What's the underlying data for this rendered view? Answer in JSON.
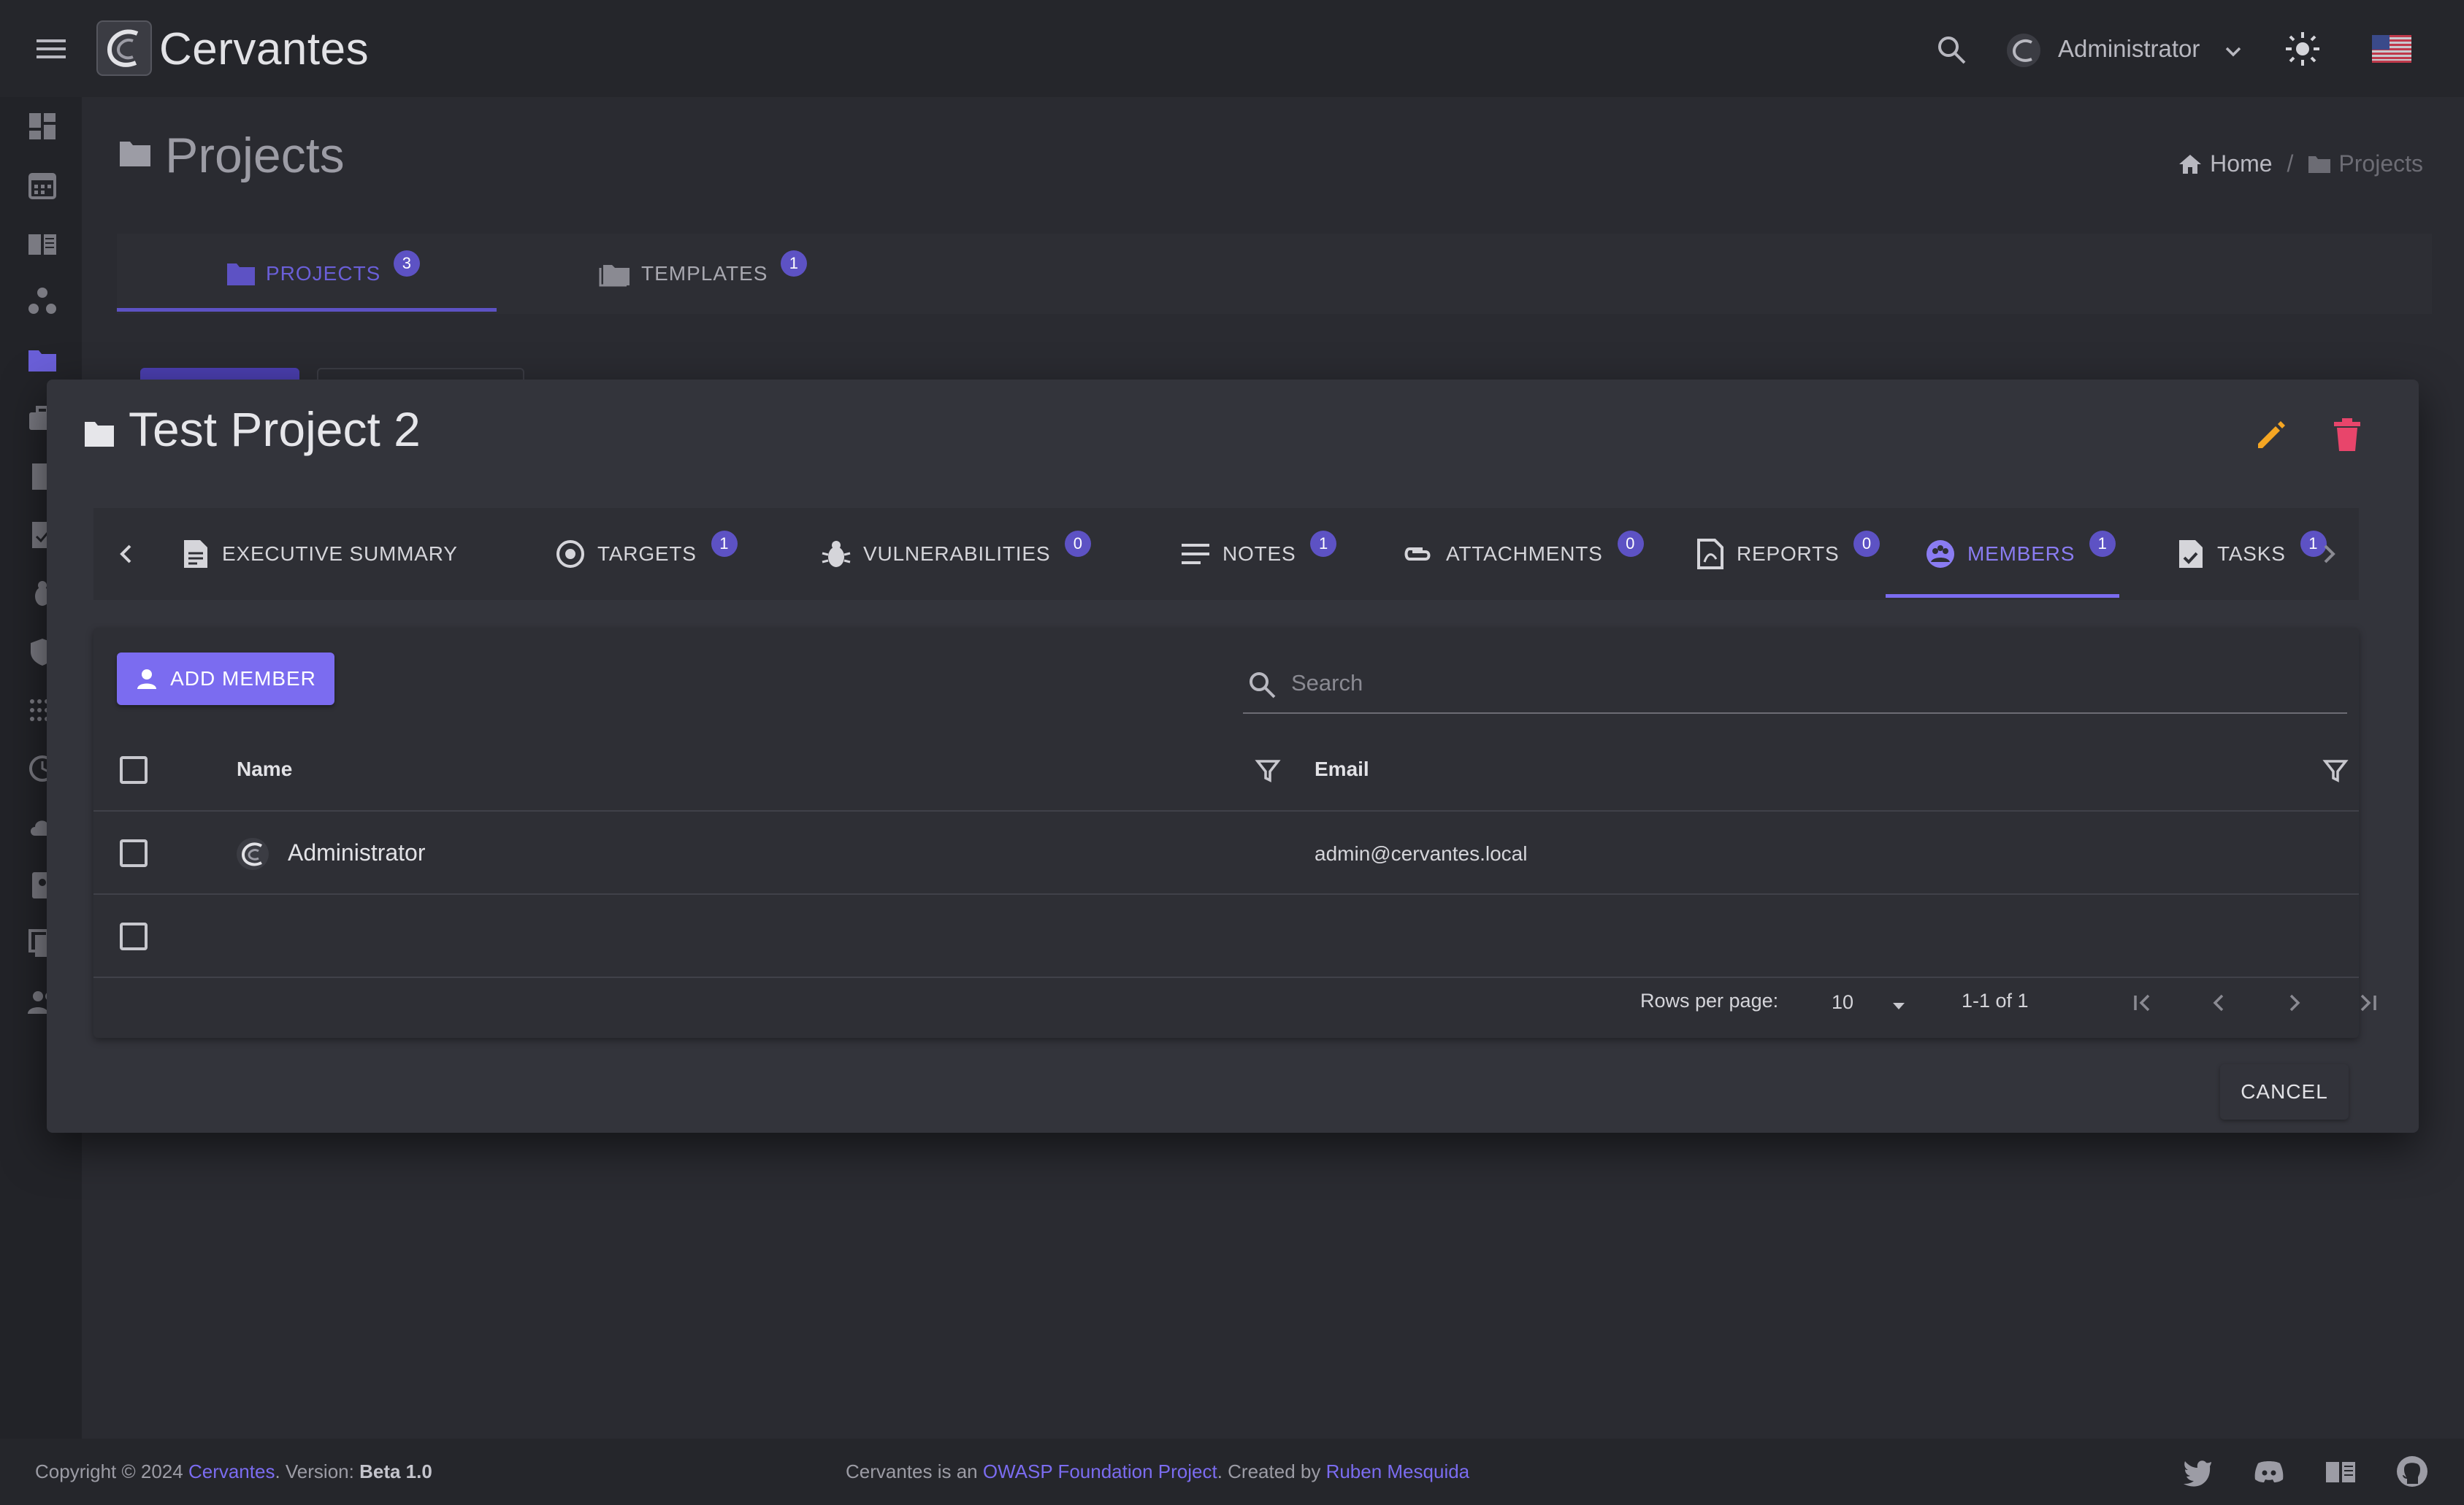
{
  "app": {
    "brand": "Cervantes"
  },
  "topbar": {
    "user": "Administrator"
  },
  "page": {
    "title": "Projects",
    "breadcrumb": {
      "home": "Home",
      "current": "Projects"
    },
    "tabs": [
      {
        "label": "PROJECTS",
        "badge": "3"
      },
      {
        "label": "TEMPLATES",
        "badge": "1"
      }
    ]
  },
  "dialog": {
    "title": "Test Project 2",
    "tabs": [
      {
        "label": "EXECUTIVE SUMMARY",
        "badge": ""
      },
      {
        "label": "TARGETS",
        "badge": "1"
      },
      {
        "label": "VULNERABILITIES",
        "badge": "0"
      },
      {
        "label": "NOTES",
        "badge": "1"
      },
      {
        "label": "ATTACHMENTS",
        "badge": "0"
      },
      {
        "label": "REPORTS",
        "badge": "0"
      },
      {
        "label": "MEMBERS",
        "badge": "1"
      },
      {
        "label": "TASKS",
        "badge": "1"
      }
    ],
    "add_member_label": "ADD MEMBER",
    "search_placeholder": "Search",
    "table": {
      "columns": [
        "Name",
        "Email"
      ],
      "rows": [
        {
          "name": "Administrator",
          "email": "admin@cervantes.local"
        }
      ]
    },
    "pager": {
      "rows_per_page_label": "Rows per page:",
      "rows_per_page_value": "10",
      "range": "1-1 of 1"
    },
    "cancel_label": "CANCEL"
  },
  "footer": {
    "copyright_prefix": "Copyright © 2024 ",
    "copyright_link": "Cervantes",
    "version_prefix": ". Version: ",
    "version": "Beta 1.0",
    "center_prefix": "Cervantes is an ",
    "owasp_link": "OWASP Foundation Project",
    "created_by": ". Created by ",
    "author_link": "Ruben Mesquida"
  },
  "colors": {
    "accent": "#7b6cf0",
    "edit": "#f5a623",
    "delete": "#e8456b",
    "background": "#2a2b31"
  }
}
